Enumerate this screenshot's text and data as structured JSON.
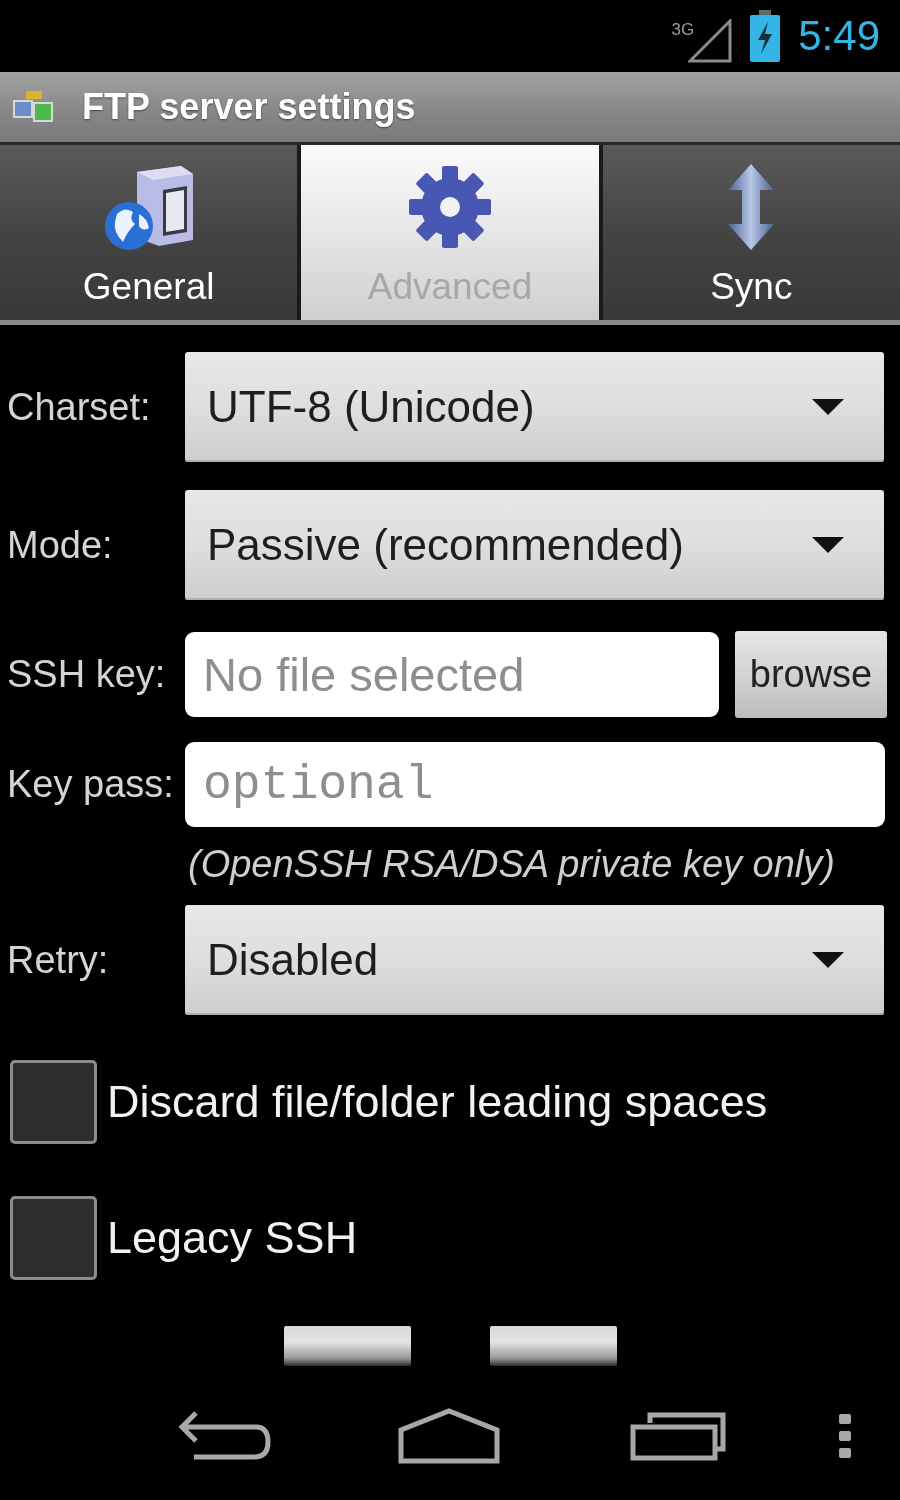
{
  "status_bar": {
    "network": "3G",
    "time": "5:49"
  },
  "window": {
    "title": "FTP server settings"
  },
  "tabs": [
    {
      "label": "General",
      "selected": false
    },
    {
      "label": "Advanced",
      "selected": true
    },
    {
      "label": "Sync",
      "selected": false
    }
  ],
  "fields": [
    {
      "kind": "dropdown",
      "label": "Charset:",
      "value": "UTF-8 (Unicode)"
    },
    {
      "kind": "dropdown",
      "label": "Mode:",
      "value": "Passive (recommended)"
    },
    {
      "kind": "file",
      "label": "SSH key:",
      "placeholder": "No file selected",
      "button": "browse"
    },
    {
      "kind": "password",
      "label": "Key pass:",
      "placeholder": "optional",
      "hint": "(OpenSSH RSA/DSA private key only)"
    },
    {
      "kind": "dropdown",
      "label": "Retry:",
      "value": "Disabled"
    }
  ],
  "checkboxes": [
    {
      "label": "Discard file/folder leading spaces",
      "checked": false
    },
    {
      "label": "Legacy SSH",
      "checked": false
    }
  ]
}
